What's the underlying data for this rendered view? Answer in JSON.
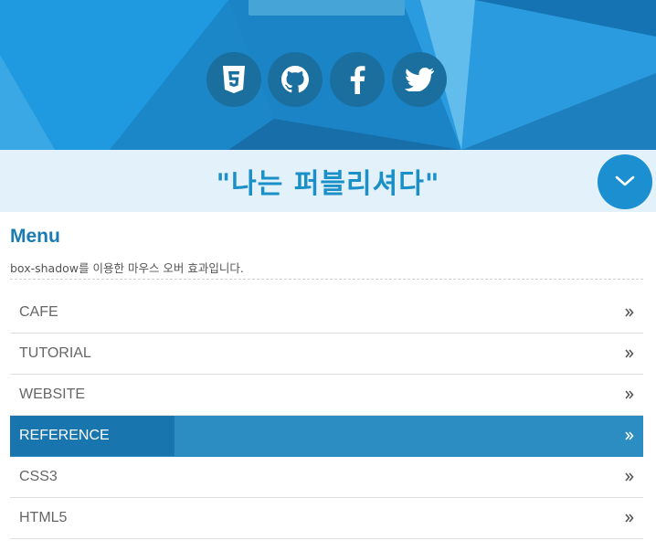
{
  "header": {
    "social_links": [
      {
        "icon": "html5-icon"
      },
      {
        "icon": "github-icon"
      },
      {
        "icon": "facebook-icon"
      },
      {
        "icon": "twitter-icon"
      }
    ],
    "colors": {
      "primary": "#1d8fd3",
      "social_bg": "#1b6f9e"
    }
  },
  "banner": {
    "title": "\"나는 퍼블리셔다\"",
    "scroll_icon": "chevron-down-icon"
  },
  "menu": {
    "heading": "Menu",
    "description": "box-shadow를 이용한 마우스 오버 효과입니다.",
    "items": [
      {
        "label": "CAFE",
        "active": false
      },
      {
        "label": "TUTORIAL",
        "active": false
      },
      {
        "label": "WEBSITE",
        "active": false
      },
      {
        "label": "REFERENCE",
        "active": true
      },
      {
        "label": "CSS3",
        "active": false
      },
      {
        "label": "HTML5",
        "active": false
      }
    ],
    "item_icon": "double-chevron-right-icon",
    "active_color": "#2b8dc2"
  }
}
